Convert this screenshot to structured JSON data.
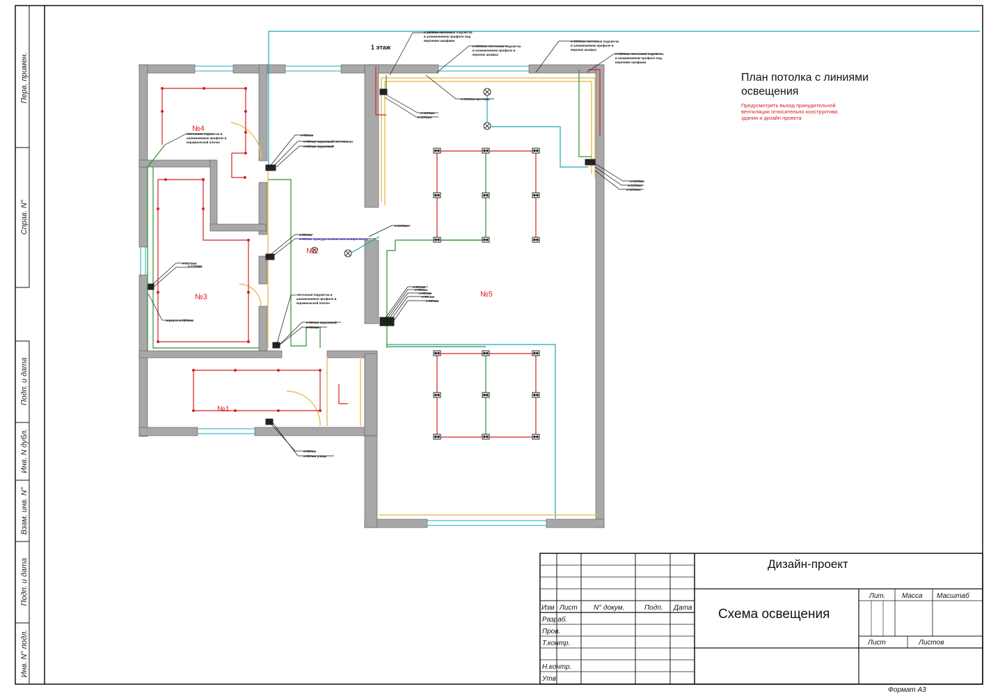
{
  "floor_label": "1 этаж",
  "plan_title": [
    "План потолка с линиями",
    "освещения"
  ],
  "plan_note": [
    "Предусмотреть выход принудительной",
    "вентиляции относительно конструктива",
    "здания и дизайн проекта"
  ],
  "rooms": {
    "r1": "№1",
    "r2": "№2",
    "r3": "№3",
    "r4": "№4",
    "r5": "№5"
  },
  "side_stamp": [
    "Перв. примен.",
    "Справ. N°",
    "Подп. и дата",
    "Инв. N дубл.",
    "Взам. инв. N°",
    "Подп. и дата",
    "Инв. N° подл."
  ],
  "annotations": {
    "a1": [
      "н-1500мм ленточная подсветка",
      "в алюминиевом профиле под",
      "верхними шкафами"
    ],
    "a2": [
      "н-2000мм ленточная подсветка",
      "в алюминиевом профиле в",
      "верхних шкафах"
    ],
    "a3": [
      "н-2000мм ленточная подсветка",
      "в алюминиевом профиле в",
      "верхних шкафах"
    ],
    "a4": [
      "н-1500мм ленточная подсветка",
      "в алюминиевом профиле под",
      "верхними шкафами"
    ],
    "a5": "н-2000мм вытяжка",
    "a6": [
      "н-1100мм",
      "н-1100мм"
    ],
    "a7": [
      "н-1100мм",
      "н-1100мм",
      "н-1100мм"
    ],
    "a8": [
      "н-900мм",
      "н-900мм маршевый лестничная",
      "н-900мм маршевый"
    ],
    "a9": [
      "н-900мм",
      "н-900мм принудительная вентиляция возле"
    ],
    "a10": "н-1100мм",
    "a11": [
      "н-1100мм",
      "н-1100мм"
    ],
    "a12": "зеркало н-1500мм",
    "a13": [
      "ленточная подсветка в",
      "алюминиевом профиле в",
      "керамической плитке"
    ],
    "a14": [
      "ленточная подсветка в",
      "алюминиевом профиле и",
      "керамической плитке"
    ],
    "a15": [
      "н-900мм маршевый",
      "н-900мм"
    ],
    "a16": [
      "н-900мм",
      "н-900мм",
      "н-900мм",
      "н-900мм",
      "н-900мм"
    ],
    "a17": [
      "н-900мм",
      "н-900мм улица"
    ]
  },
  "title_block": {
    "company": "Дизайн-проект",
    "drawing": "Схема освещения",
    "cols": [
      "Изм",
      "Лист",
      "N° докум.",
      "Подп.",
      "Дата"
    ],
    "rows": [
      "Разраб.",
      "Пров.",
      "Т.контр.",
      "Н.контр.",
      "Утв."
    ],
    "lit": "Лит.",
    "massa": "Масса",
    "masshtab": "Масштаб",
    "list": "Лист",
    "listov": "Листов",
    "format": "Формат А3"
  },
  "colors": {
    "wall": "#a8a8a8",
    "red_line": "#d62020",
    "green_line": "#2a8f2a",
    "cyan_line": "#1aa8b8",
    "yellow_strip": "#e8c060",
    "note_red": "#d62020",
    "vent_blue": "#2222cc"
  }
}
